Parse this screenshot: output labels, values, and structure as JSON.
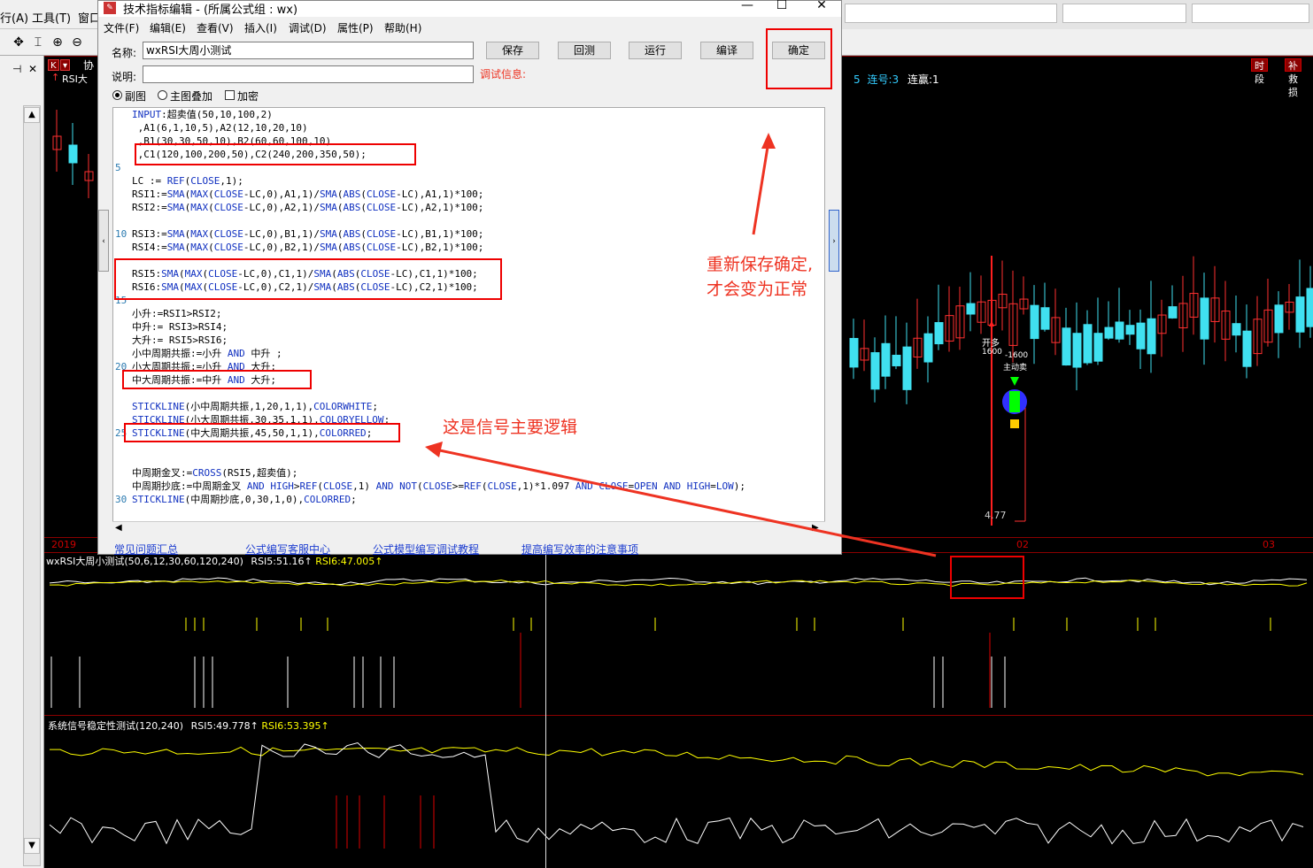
{
  "app_menu": {
    "items": [
      "行(A)",
      "工具(T)",
      "窗口"
    ]
  },
  "toolbar_icons": [
    "move-icon",
    "cursor-icon",
    "zoom-in-icon",
    "zoom-out-icon"
  ],
  "chart": {
    "k_button": "K",
    "header_left": "协",
    "indicator_left": "RSI大",
    "stats_prefix": "5",
    "stats_win": "连号:3",
    "stats_gain": "连赢:1",
    "right_buttons": [
      "时段",
      "补救损"
    ],
    "annotations": {
      "open_long": "开多",
      "open_price": "1600",
      "neg_price": "-1600",
      "active_sell": "主动卖",
      "low_price": "4.77"
    },
    "xaxis": [
      "2019",
      "02",
      "03"
    ]
  },
  "indicator1": {
    "name": "wxRSI大周小测试(50,6,12,30,60,120,240)",
    "rsi5_label": "RSI5:",
    "rsi5_value": "51.16",
    "rsi6_label": "RSI6:",
    "rsi6_value": "47.005",
    "arrow": "↑"
  },
  "indicator2": {
    "name": "系统信号稳定性测试(120,240)",
    "rsi5_label": "RSI5:",
    "rsi5_value": "49.778",
    "rsi6_label": "RSI6:",
    "rsi6_value": "53.395",
    "arrow": "↑"
  },
  "dialog": {
    "title": "技术指标编辑 - (所属公式组 : wx)",
    "menu": [
      "文件(F)",
      "编辑(E)",
      "查看(V)",
      "插入(I)",
      "调试(D)",
      "属性(P)",
      "帮助(H)"
    ],
    "name_label": "名称:",
    "name_value": "wxRSI大周小测试",
    "desc_label": "说明:",
    "desc_value": "",
    "debug_label": "调试信息:",
    "buttons": {
      "save": "保存",
      "backtest": "回测",
      "run": "运行",
      "compile": "编译",
      "ok": "确定"
    },
    "options": {
      "sub_chart": "副图",
      "main_overlay": "主图叠加",
      "encrypt": "加密"
    },
    "line_numbers": [
      "5",
      "10",
      "15",
      "20",
      "25",
      "30"
    ],
    "code": [
      "INPUT:超卖值(50,10,100,2)",
      " ,A1(6,1,10,5),A2(12,10,20,10)",
      " ,B1(30,30,50,10),B2(60,60,100,10)",
      " ,C1(120,100,200,50),C2(240,200,350,50);",
      "",
      "LC := REF(CLOSE,1);",
      "RSI1:=SMA(MAX(CLOSE-LC,0),A1,1)/SMA(ABS(CLOSE-LC),A1,1)*100;",
      "RSI2:=SMA(MAX(CLOSE-LC,0),A2,1)/SMA(ABS(CLOSE-LC),A2,1)*100;",
      "",
      "RSI3:=SMA(MAX(CLOSE-LC,0),B1,1)/SMA(ABS(CLOSE-LC),B1,1)*100;",
      "RSI4:=SMA(MAX(CLOSE-LC,0),B2,1)/SMA(ABS(CLOSE-LC),B2,1)*100;",
      "",
      "RSI5:SMA(MAX(CLOSE-LC,0),C1,1)/SMA(ABS(CLOSE-LC),C1,1)*100;",
      "RSI6:SMA(MAX(CLOSE-LC,0),C2,1)/SMA(ABS(CLOSE-LC),C2,1)*100;",
      "",
      "小升:=RSI1>RSI2;",
      "中升:= RSI3>RSI4;",
      "大升:= RSI5>RSI6;",
      "小中周期共振:=小升 AND 中升 ;",
      "小大周期共振:=小升 AND 大升;",
      "中大周期共振:=中升 AND 大升;",
      "",
      "STICKLINE(小中周期共振,1,20,1,1),COLORWHITE;",
      "STICKLINE(小大周期共振,30,35,1,1),COLORYELLOW;",
      "STICKLINE(中大周期共振,45,50,1,1),COLORRED;",
      "",
      "",
      "中周期金叉:=CROSS(RSI5,超卖值);",
      "中周期抄底:=中周期金叉 AND HIGH>REF(CLOSE,1) AND NOT(CLOSE>=REF(CLOSE,1)*1.097 AND CLOSE=OPEN AND HIGH=LOW);",
      "STICKLINE(中周期抄底,0,30,1,0),COLORRED;"
    ],
    "links": [
      "常见问题汇总",
      "公式编写客服中心",
      "公式模型编写调试教程",
      "提高编写效率的注意事项"
    ]
  },
  "callouts": {
    "save_note_line1": "重新保存确定,",
    "save_note_line2": "才会变为正常",
    "logic_note": "这是信号主要逻辑"
  },
  "colors": {
    "bull": "#ff3030",
    "bear": "#40e0f0",
    "annot": "#e32",
    "yellow": "#ffff00"
  }
}
